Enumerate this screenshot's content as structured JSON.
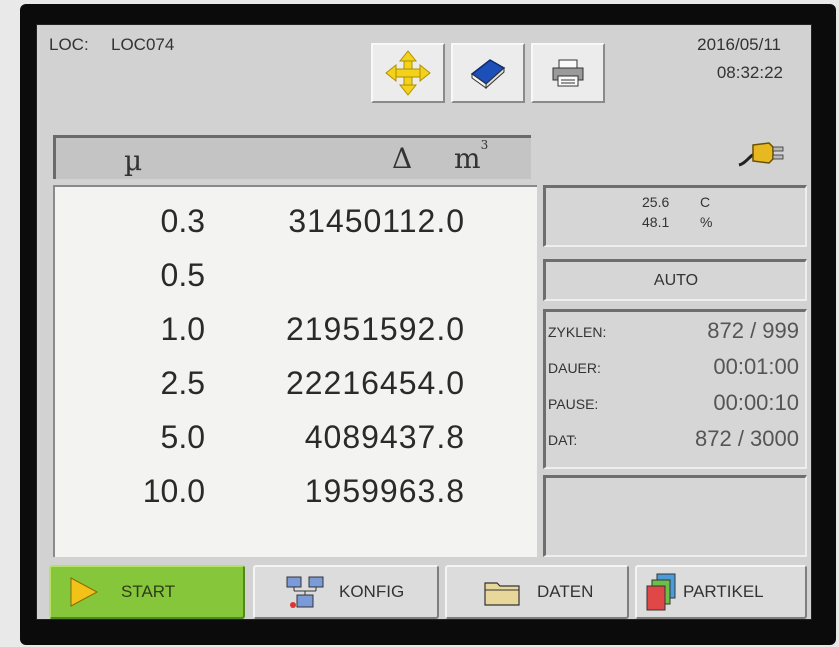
{
  "header": {
    "loc_label": "LOC:",
    "loc_value": "LOC074",
    "date": "2016/05/11",
    "time": "08:32:22"
  },
  "toolbar_icons": [
    "move-arrows-icon",
    "book-icon",
    "printer-icon"
  ],
  "columns": {
    "size": "µ",
    "count": "Δ",
    "unit": "m",
    "unit_sup": "3"
  },
  "rows": [
    {
      "size": "0.3",
      "count": "31450112.0"
    },
    {
      "size": "0.5",
      "count": ""
    },
    {
      "size": "1.0",
      "count": "21951592.0"
    },
    {
      "size": "2.5",
      "count": "22216454.0"
    },
    {
      "size": "5.0",
      "count": "4089437.8"
    },
    {
      "size": "10.0",
      "count": "1959963.8"
    }
  ],
  "environment": {
    "temperature": "25.6",
    "temperature_unit": "C",
    "humidity": "48.1",
    "humidity_unit": "%"
  },
  "mode": "AUTO",
  "stats": [
    {
      "label": "ZYKLEN:",
      "value": "872 / 999"
    },
    {
      "label": "DAUER:",
      "value": "00:01:00"
    },
    {
      "label": "PAUSE:",
      "value": "00:00:10"
    },
    {
      "label": "DAT:",
      "value": "872 / 3000"
    }
  ],
  "nav": {
    "start": "START",
    "konfig": "KONFIG",
    "daten": "DATEN",
    "partikel": "PARTIKEL"
  },
  "colors": {
    "start_green": "#86c63a",
    "move_icon_yellow": "#f2d21a",
    "book_blue": "#1d4fb8"
  }
}
